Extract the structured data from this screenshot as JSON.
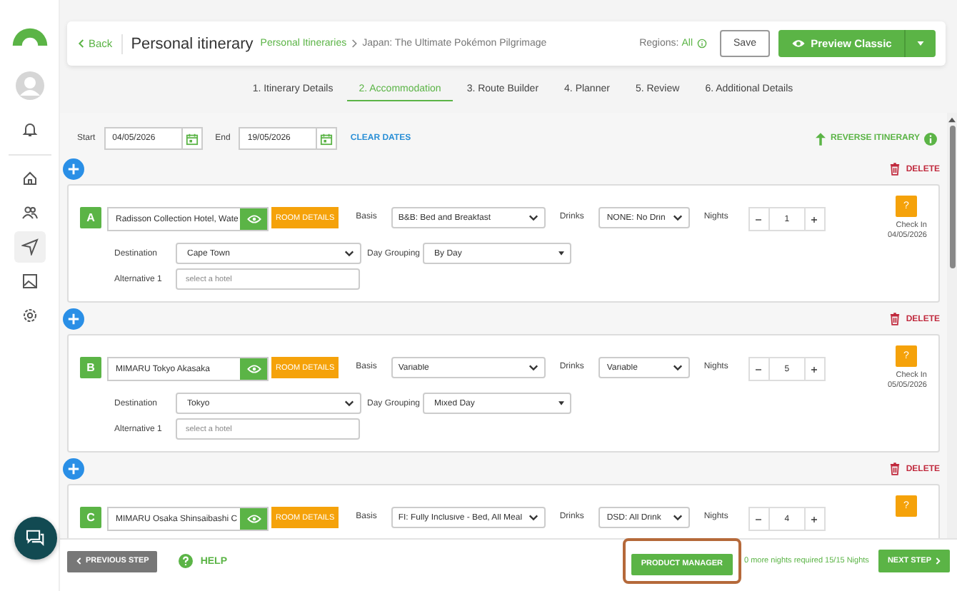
{
  "sidebar": {
    "items": [
      {
        "selected": false
      },
      {
        "selected": false
      },
      {
        "selected": true
      },
      {
        "selected": false
      },
      {
        "selected": false
      }
    ]
  },
  "header": {
    "back": "Back",
    "title": "Personal itinerary",
    "breadcrumb": [
      "Personal Itineraries",
      "Japan: The Ultimate Pokémon Pilgrimage"
    ],
    "regions_label": "Regions:",
    "regions_value": "All",
    "save": "Save",
    "preview": "Preview Classic"
  },
  "tabs": [
    {
      "label": "1. Itinerary Details",
      "selected": false
    },
    {
      "label": "2. Accommodation",
      "selected": true
    },
    {
      "label": "3. Route Builder",
      "selected": false
    },
    {
      "label": "4. Planner",
      "selected": false
    },
    {
      "label": "5. Review",
      "selected": false
    },
    {
      "label": "6. Additional Details",
      "selected": false
    }
  ],
  "dates": {
    "start_label": "Start",
    "start": "04/05/2026",
    "end_label": "End",
    "end": "19/05/2026",
    "clear": "CLEAR DATES",
    "reverse": "REVERSE ITINERARY"
  },
  "stays": [
    {
      "delete": "DELETE",
      "letter": "A",
      "hotel": "Radisson Collection Hotel, Wate",
      "room_details": "ROOM DETAILS",
      "basis_label": "Basis",
      "basis": "B&B: Bed and Breakfast",
      "drinks_label": "Drinks",
      "drinks": "NONE: No Drin",
      "nights_label": "Nights",
      "nights": "1",
      "help": "?",
      "check_in_label": "Check In",
      "check_in": "04/05/2026",
      "destination_label": "Destination",
      "destination": "Cape Town",
      "grouping_label": "Day Grouping",
      "grouping": "By Day",
      "alt_label": "Alternative 1",
      "alt_placeholder": "select a hotel"
    },
    {
      "delete": "DELETE",
      "letter": "B",
      "hotel": "MIMARU Tokyo Akasaka",
      "room_details": "ROOM DETAILS",
      "basis_label": "Basis",
      "basis": "Variable",
      "drinks_label": "Drinks",
      "drinks": "Variable",
      "nights_label": "Nights",
      "nights": "5",
      "help": "?",
      "check_in_label": "Check In",
      "check_in": "05/05/2026",
      "destination_label": "Destination",
      "destination": "Tokyo",
      "grouping_label": "Day Grouping",
      "grouping": "Mixed Day",
      "alt_label": "Alternative 1",
      "alt_placeholder": "select a hotel"
    },
    {
      "delete": "DELETE",
      "letter": "C",
      "hotel": "MIMARU Osaka Shinsaibashi C",
      "room_details": "ROOM DETAILS",
      "basis_label": "Basis",
      "basis": "FI: Fully Inclusive - Bed, All Meal",
      "drinks_label": "Drinks",
      "drinks": "DSD: All Drink",
      "nights_label": "Nights",
      "nights": "4",
      "help": "?"
    }
  ],
  "footer": {
    "previous": "PREVIOUS STEP",
    "help": "HELP",
    "product_manager": "PRODUCT MANAGER",
    "product_manager_highlighted": true,
    "nights_note": "0 more nights required 15/15 Nights",
    "next": "NEXT STEP"
  }
}
